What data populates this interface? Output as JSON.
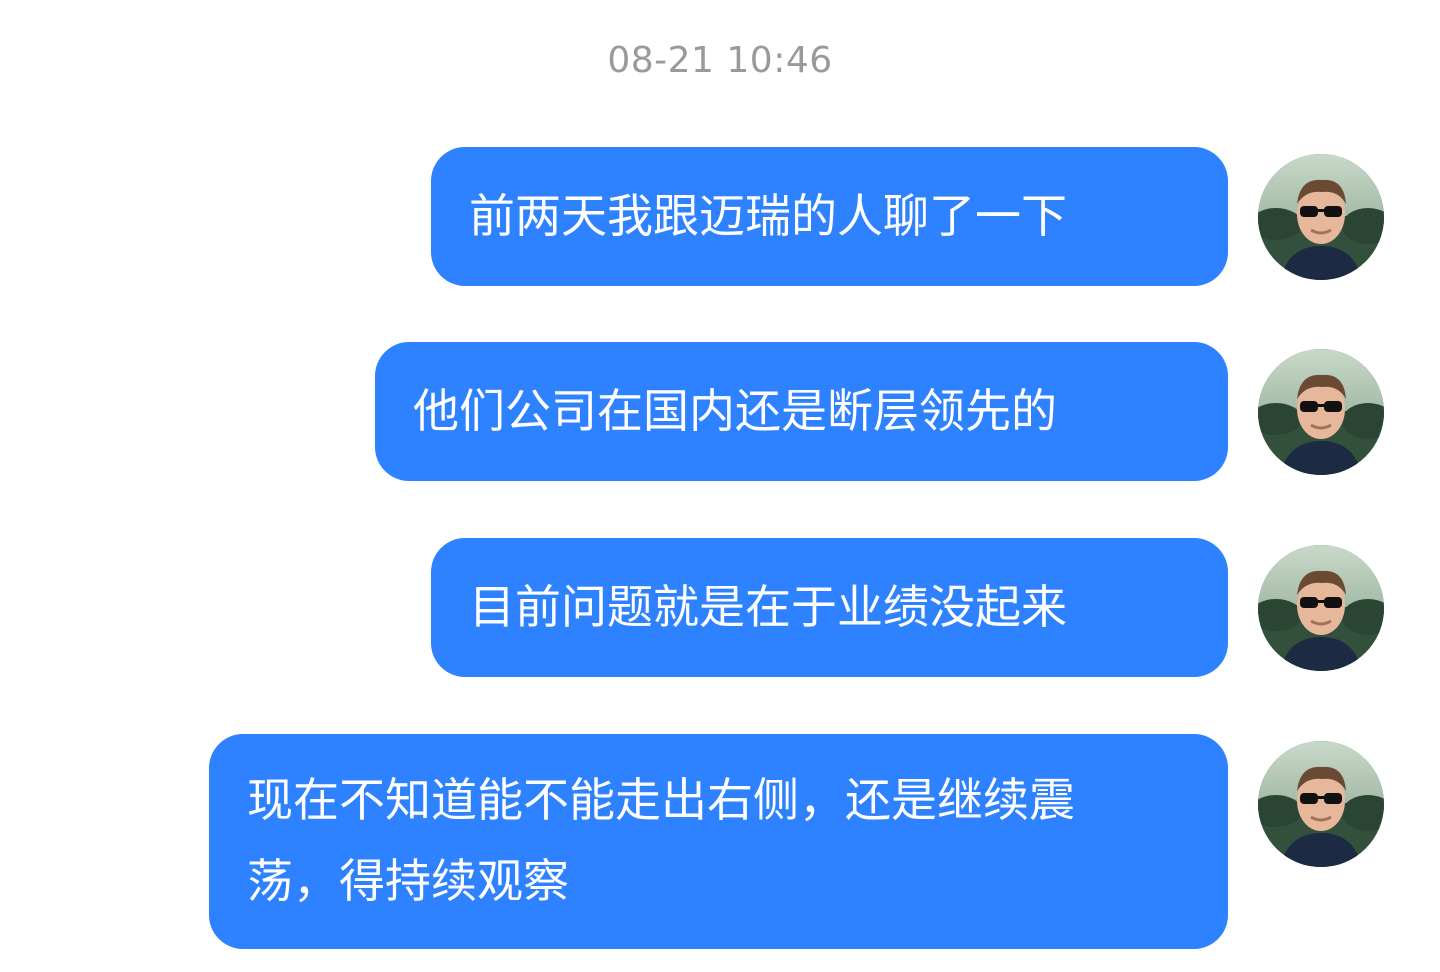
{
  "chat": {
    "timestamp": "08-21 10:46",
    "messages": [
      {
        "text": "前两天我跟迈瑞的人聊了一下"
      },
      {
        "text": "他们公司在国内还是断层领先的"
      },
      {
        "text": "目前问题就是在于业绩没起来"
      },
      {
        "text": "现在不知道能不能走出右侧，还是继续震荡，得持续观察"
      }
    ]
  },
  "colors": {
    "bubble": "#2e82ff",
    "bubble_text": "#ffffff",
    "timestamp": "#9a9a9a",
    "background": "#ffffff"
  }
}
